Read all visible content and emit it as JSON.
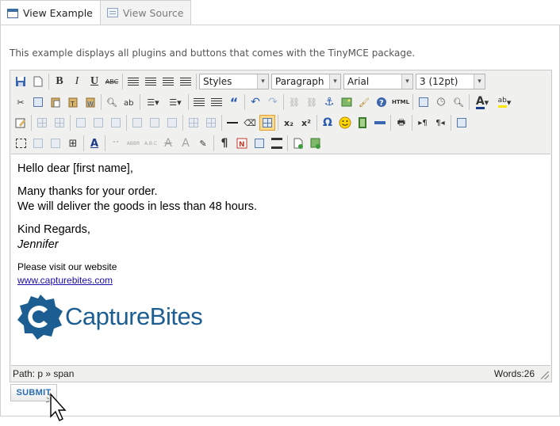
{
  "tabs": [
    {
      "label": "View Example",
      "icon": "window-icon",
      "active": true
    },
    {
      "label": "View Source",
      "icon": "source-icon",
      "active": false
    }
  ],
  "description": "This example displays all plugins and buttons that comes with the TinyMCE package.",
  "toolbar": {
    "styles_select": "Styles",
    "format_select": "Paragraph",
    "font_select": "Arial",
    "size_select": "3 (12pt)",
    "strike_label": "ABC",
    "html_label": "HTML",
    "omega": "Ω",
    "paragraph_mark": "¶",
    "sub_label": "x₂",
    "sup_label": "x²"
  },
  "content": {
    "greeting": "Hello dear [first name],",
    "line1": "Many thanks for your order.",
    "line2": "We will deliver the goods in less than 48 hours.",
    "regards": "Kind Regards,",
    "signature": "Jennifer",
    "visit": "Please visit our website",
    "link": "www.capturebites.com",
    "logo_text": "CaptureBites"
  },
  "statusbar": {
    "path": "Path: p » span",
    "words": "Words:26"
  },
  "submit_label": "SUBMIT",
  "colors": {
    "accent": "#2a6db5",
    "logo": "#1c5e91",
    "link": "#1a0dab"
  }
}
